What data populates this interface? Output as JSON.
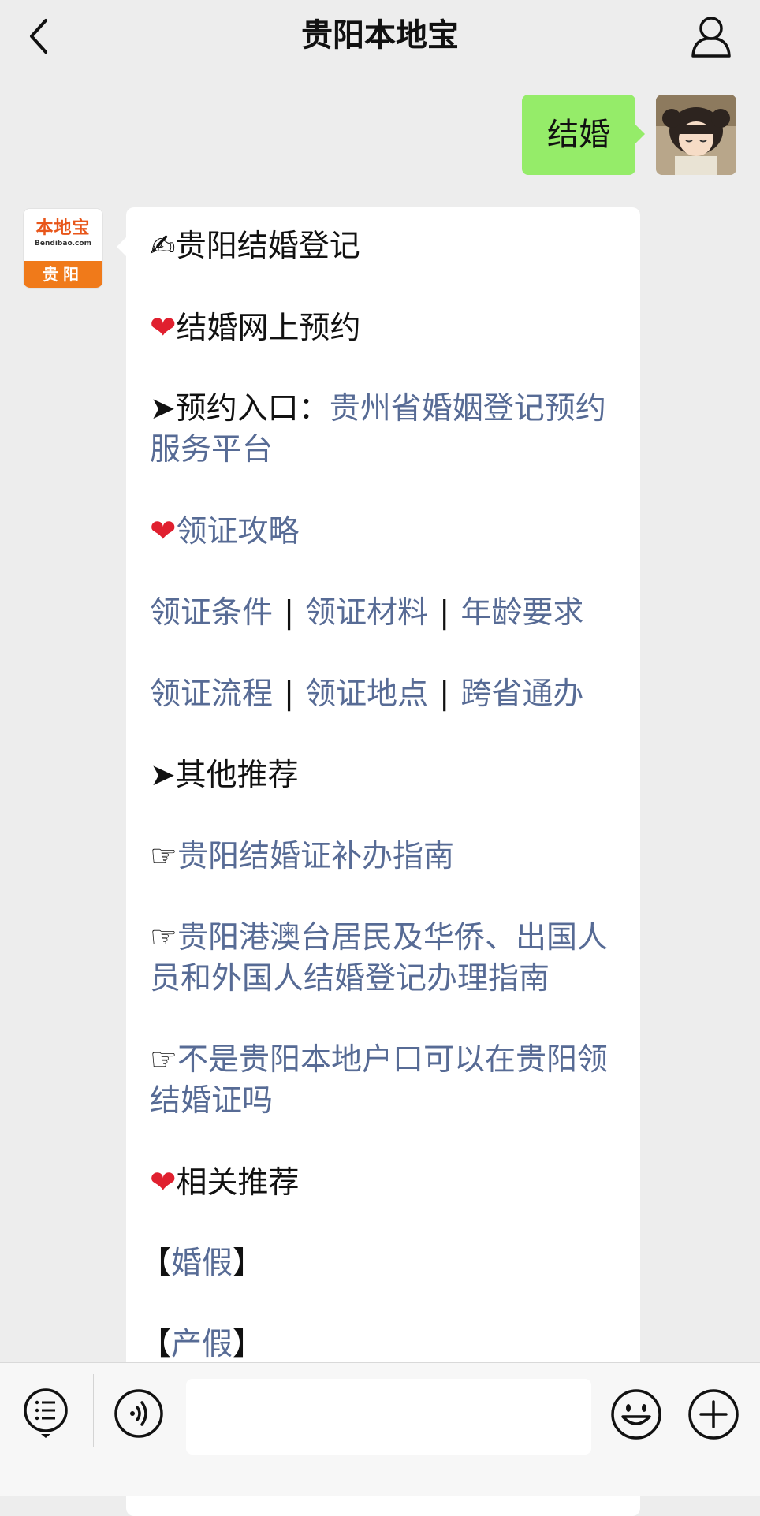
{
  "header": {
    "title": "贵阳本地宝",
    "back_icon": "chevron-left-icon",
    "profile_icon": "person-icon"
  },
  "outgoing": {
    "text": "结婚",
    "bubble_color": "#95ec69"
  },
  "bot_avatar": {
    "logo_name": "本地宝",
    "logo_domain": "Bendibao.com",
    "logo_city": "贵阳",
    "brand_color": "#f07a1a"
  },
  "reply": {
    "title_icon": "✍",
    "title": "贵阳结婚登记",
    "section1_icon": "❤",
    "section1": "结婚网上预约",
    "entry_prefix": "➤预约入口：",
    "entry_link": "贵州省婚姻登记预约服务平台",
    "section2_icon": "❤",
    "section2_link": "领证攻略",
    "links_row1": [
      "领证条件",
      "领证材料",
      "年龄要求"
    ],
    "links_row2": [
      "领证流程",
      "领证地点",
      "跨省通办"
    ],
    "separator": "|",
    "other_heading": "➤其他推荐",
    "pointer": "☞",
    "rec1": "贵阳结婚证补办指南",
    "rec2": "贵阳港澳台居民及华侨、出国人员和外国人结婚登记办理指南",
    "rec3": "不是贵阳本地户口可以在贵阳领结婚证吗",
    "section3_icon": "❤",
    "section3": "相关推荐",
    "bracket_open": "【",
    "bracket_close": "】",
    "related1": "婚假",
    "related2": "产假",
    "link_color": "#576b95"
  },
  "input_bar": {
    "menu_icon": "list-menu-icon",
    "voice_icon": "voice-icon",
    "input_value": "",
    "emoji_icon": "emoji-icon",
    "plus_icon": "plus-icon"
  }
}
